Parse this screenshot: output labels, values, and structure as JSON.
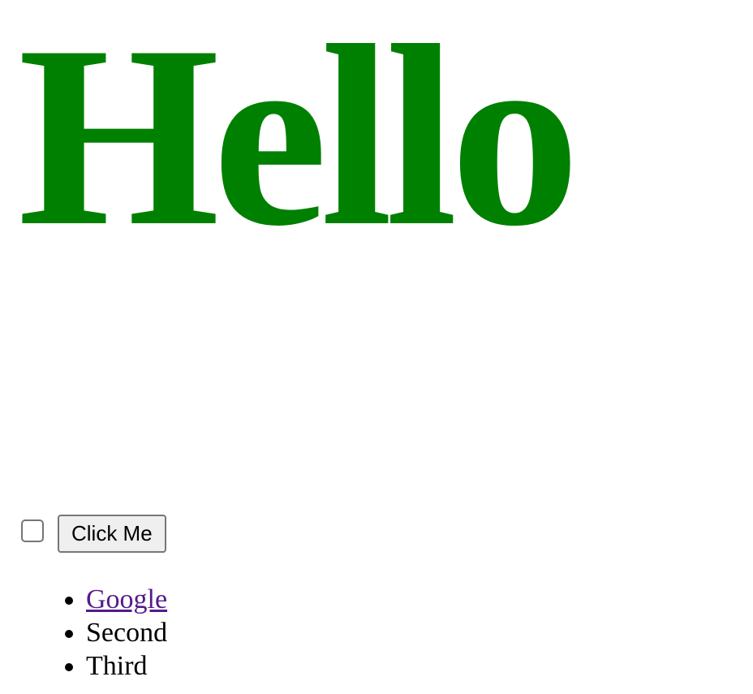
{
  "heading": {
    "text": "Hello",
    "color": "#008000"
  },
  "controls": {
    "checkbox_checked": false,
    "button_label": "Click Me"
  },
  "list": {
    "items": [
      {
        "label": "Google",
        "is_link": true,
        "link_color": "#551a8b"
      },
      {
        "label": "Second",
        "is_link": false
      },
      {
        "label": "Third",
        "is_link": false
      }
    ]
  }
}
